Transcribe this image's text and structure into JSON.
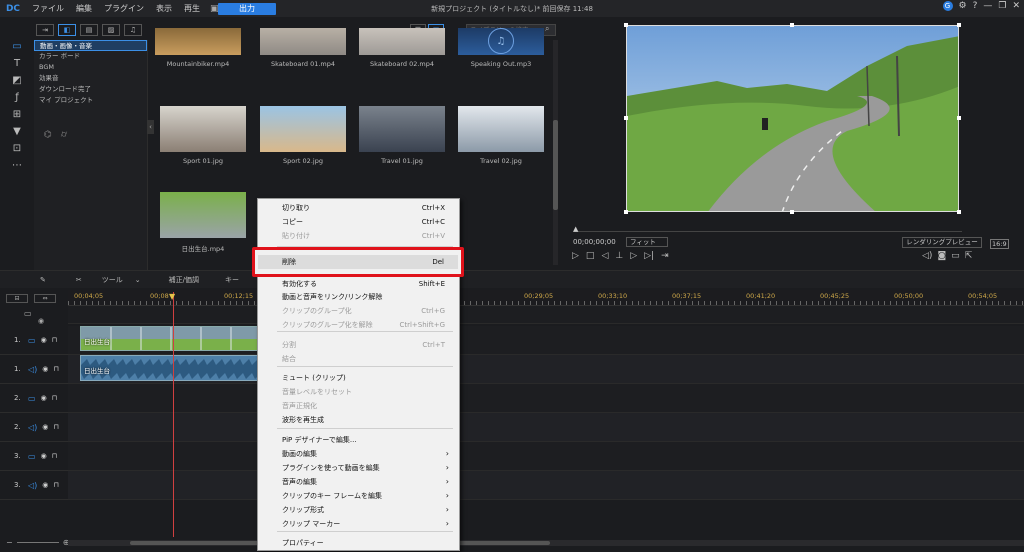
{
  "app": {
    "logo": "DC",
    "menu": [
      "ファイル",
      "編集",
      "プラグイン",
      "表示",
      "再生"
    ],
    "export_label": "出力",
    "project_title": "新規プロジェクト (タイトルなし)* 前回保存 11:48",
    "user_initial": "G",
    "window_controls": [
      "?",
      "—",
      "❐",
      "✕"
    ]
  },
  "library": {
    "search_placeholder": "ライブラリーの検索",
    "categories": [
      "動画・画像・音楽",
      "カラー ボード",
      "BGM",
      "効果音",
      "ダウンロード完了",
      "マイ プロジェクト"
    ],
    "media": [
      {
        "name": "Mountainbiker.mp4",
        "colors": [
          "#8a6a3a",
          "#c99d5e"
        ]
      },
      {
        "name": "Skateboard 01.mp4",
        "colors": [
          "#b8b0a5",
          "#8f8a85"
        ]
      },
      {
        "name": "Skateboard 02.mp4",
        "colors": [
          "#c8c2bb",
          "#9e9a96"
        ]
      },
      {
        "name": "Speaking Out.mp3",
        "colors": [
          "#1d3b66",
          "#2c5d9c"
        ]
      },
      {
        "name": "Sport 01.jpg",
        "colors": [
          "#d7d4cd",
          "#8b7f74"
        ]
      },
      {
        "name": "Sport 02.jpg",
        "colors": [
          "#9bc4e4",
          "#d9b88a"
        ]
      },
      {
        "name": "Travel 01.jpg",
        "colors": [
          "#7a828c",
          "#3a4250"
        ]
      },
      {
        "name": "Travel 02.jpg",
        "colors": [
          "#e2e7ec",
          "#8c9aa8"
        ]
      },
      {
        "name": "日出生台.mp4",
        "colors": [
          "#7ab04a",
          "#9aa3a8"
        ]
      }
    ]
  },
  "preview": {
    "timecode": "00;00;00;00",
    "fit_label": "フィット",
    "render_label": "レンダリングプレビュー",
    "aspect": "16:9"
  },
  "timeline": {
    "toolbar": [
      "ツール",
      "補正/価調",
      "キー"
    ],
    "ruler_labels": [
      "00;04;05",
      "00;08",
      "00;12;15",
      "00;29;05",
      "00;33;10",
      "00;37;15",
      "00;41;20",
      "00;45;25",
      "00;50;00",
      "00;54;05"
    ],
    "tracks": [
      {
        "num": "1.",
        "icon": "▭"
      },
      {
        "num": "1.",
        "icon": "◁)"
      },
      {
        "num": "2.",
        "icon": "▭"
      },
      {
        "num": "2.",
        "icon": "◁)"
      },
      {
        "num": "3.",
        "icon": "▭"
      },
      {
        "num": "3.",
        "icon": "◁)"
      }
    ],
    "video_clip_label": "日出生台",
    "audio_clip_label": "日出生台"
  },
  "context_menu": {
    "items": [
      {
        "label": "切り取り",
        "shortcut": "Ctrl+X",
        "disabled": false
      },
      {
        "label": "コピー",
        "shortcut": "Ctrl+C",
        "disabled": false
      },
      {
        "label": "貼り付け",
        "shortcut": "Ctrl+V",
        "disabled": true,
        "arrow": true
      },
      {
        "label": "削除",
        "shortcut": "Del",
        "disabled": false
      },
      {
        "label": "有効化する",
        "shortcut": "Shift+E",
        "disabled": false
      },
      {
        "label": "動画と音声をリンク/リンク解除",
        "shortcut": "",
        "disabled": false
      },
      {
        "label": "クリップのグループ化",
        "shortcut": "Ctrl+G",
        "disabled": true
      },
      {
        "label": "クリップのグループ化を解除",
        "shortcut": "Ctrl+Shift+G",
        "disabled": true
      },
      {
        "label": "分割",
        "shortcut": "Ctrl+T",
        "disabled": true
      },
      {
        "label": "結合",
        "shortcut": "",
        "disabled": true
      },
      {
        "label": "ミュート (クリップ)",
        "shortcut": "",
        "disabled": false
      },
      {
        "label": "音量レベルをリセット",
        "shortcut": "",
        "disabled": true
      },
      {
        "label": "音声正規化",
        "shortcut": "",
        "disabled": true
      },
      {
        "label": "波形を再生成",
        "shortcut": "",
        "disabled": false
      },
      {
        "label": "PiP デザイナーで編集...",
        "shortcut": "",
        "disabled": false
      },
      {
        "label": "動画の編集",
        "shortcut": "",
        "disabled": false,
        "arrow": true
      },
      {
        "label": "プラグインを使って動画を編集",
        "shortcut": "",
        "disabled": false,
        "arrow": true
      },
      {
        "label": "音声の編集",
        "shortcut": "",
        "disabled": false,
        "arrow": true
      },
      {
        "label": "クリップのキー フレームを編集",
        "shortcut": "",
        "disabled": false,
        "arrow": true
      },
      {
        "label": "クリップ形式",
        "shortcut": "",
        "disabled": false,
        "arrow": true
      },
      {
        "label": "クリップ マーカー",
        "shortcut": "",
        "disabled": false,
        "arrow": true
      },
      {
        "label": "プロパティー",
        "shortcut": "",
        "disabled": false
      }
    ]
  }
}
